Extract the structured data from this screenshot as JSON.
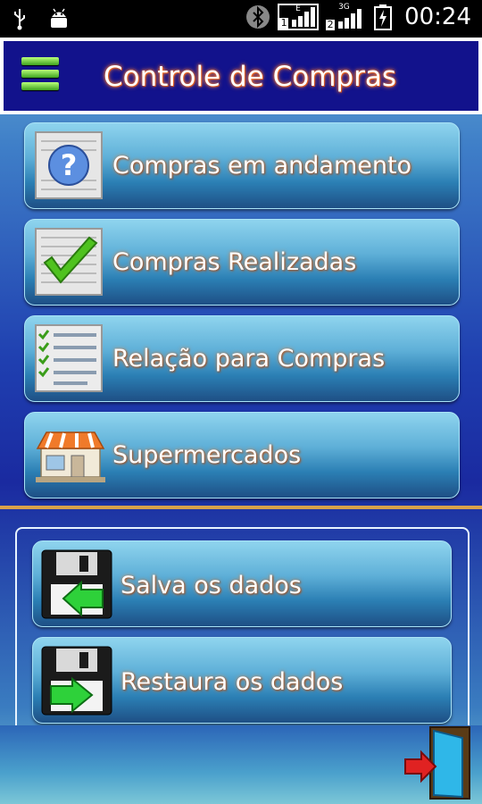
{
  "status_bar": {
    "time": "00:24",
    "icons": [
      "usb-icon",
      "android-debug-icon",
      "bluetooth-icon",
      "signal-e-icon",
      "signal-3g-icon",
      "battery-charging-icon"
    ],
    "sim1_network": "E",
    "sim1_number": "1",
    "sim2_network": "3G",
    "sim2_number": "2"
  },
  "header": {
    "title": "Controle de Compras",
    "menu_icon": "hamburger-menu-icon"
  },
  "menu": {
    "items": [
      {
        "label": "Compras em andamento",
        "icon": "question-clipboard-icon"
      },
      {
        "label": "Compras Realizadas",
        "icon": "checkmark-clipboard-icon"
      },
      {
        "label": "Relação para Compras",
        "icon": "checklist-icon"
      },
      {
        "label": "Supermercados",
        "icon": "store-icon"
      }
    ]
  },
  "data_panel": {
    "items": [
      {
        "label": "Salva os dados",
        "icon": "floppy-save-icon"
      },
      {
        "label": "Restaura os dados",
        "icon": "floppy-restore-icon"
      }
    ]
  },
  "footer": {
    "exit_icon": "exit-door-icon"
  },
  "colors": {
    "header_bg": "#12128c",
    "title_glow": "#ff7a2b",
    "button_top": "#8fd4ee",
    "button_bottom": "#1e4f85",
    "divider": "#d9a24a"
  }
}
